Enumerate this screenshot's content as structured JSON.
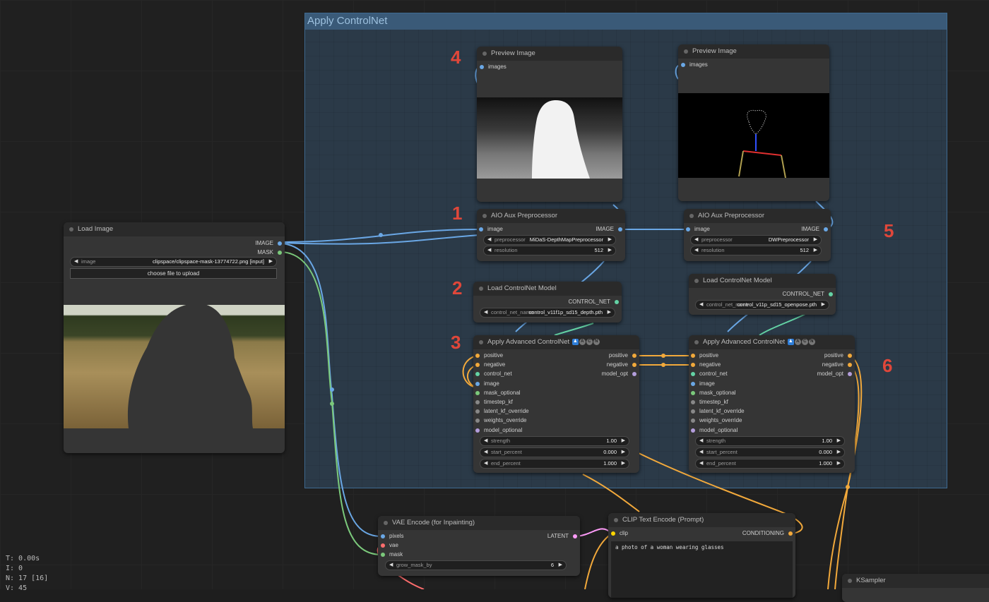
{
  "group": {
    "title": "Apply ControlNet"
  },
  "step_labels": [
    "1",
    "2",
    "3",
    "4",
    "5",
    "6"
  ],
  "stats": {
    "t": "T: 0.00s",
    "i": "I: 0",
    "n": "N: 17 [16]",
    "v": "V: 45"
  },
  "colors": {
    "image": "#6aa7e5",
    "mask": "#7bc97b",
    "conditioning": "#f2a93b",
    "control_net": "#64d3a5",
    "latent": "#ff9cf9",
    "vae": "#ff6e6e",
    "clip": "#ffd500",
    "model": "#b39ddb",
    "other": "#888888"
  },
  "load_image": {
    "title": "Load Image",
    "out_image": "IMAGE",
    "out_mask": "MASK",
    "image_label": "image",
    "image_value": "clipspace/clipspace-mask-13774722.png [input]",
    "upload_label": "choose file to upload"
  },
  "preview1": {
    "title": "Preview Image",
    "in_images": "images"
  },
  "preview2": {
    "title": "Preview Image",
    "in_images": "images"
  },
  "aio1": {
    "title": "AIO Aux Preprocessor",
    "in_image": "image",
    "out_image": "IMAGE",
    "preprocessor_label": "preprocessor",
    "preprocessor_value": "MiDaS-DepthMapPreprocessor",
    "resolution_label": "resolution",
    "resolution_value": "512"
  },
  "aio2": {
    "title": "AIO Aux Preprocessor",
    "in_image": "image",
    "out_image": "IMAGE",
    "preprocessor_label": "preprocessor",
    "preprocessor_value": "DWPreprocessor",
    "resolution_label": "resolution",
    "resolution_value": "512"
  },
  "lcm1": {
    "title": "Load ControlNet Model",
    "out": "CONTROL_NET",
    "name_label": "control_net_name",
    "name_value": "control_v11f1p_sd15_depth.pth"
  },
  "lcm2": {
    "title": "Load ControlNet Model",
    "out": "CONTROL_NET",
    "name_label": "control_net_name",
    "name_value": "control_v11p_sd15_openpose.pth"
  },
  "acn1": {
    "title": "Apply Advanced ControlNet",
    "badges": [
      "A",
      "C",
      "N"
    ],
    "inputs": [
      "positive",
      "negative",
      "control_net",
      "image",
      "mask_optional",
      "timestep_kf",
      "latent_kf_override",
      "weights_override",
      "model_optional"
    ],
    "outputs": [
      "positive",
      "negative",
      "model_opt"
    ],
    "widgets": [
      {
        "name": "strength",
        "value": "1.00"
      },
      {
        "name": "start_percent",
        "value": "0.000"
      },
      {
        "name": "end_percent",
        "value": "1.000"
      }
    ]
  },
  "acn2": {
    "title": "Apply Advanced ControlNet",
    "badges": [
      "A",
      "C",
      "N"
    ],
    "inputs": [
      "positive",
      "negative",
      "control_net",
      "image",
      "mask_optional",
      "timestep_kf",
      "latent_kf_override",
      "weights_override",
      "model_optional"
    ],
    "outputs": [
      "positive",
      "negative",
      "model_opt"
    ],
    "widgets": [
      {
        "name": "strength",
        "value": "1.00"
      },
      {
        "name": "start_percent",
        "value": "0.000"
      },
      {
        "name": "end_percent",
        "value": "1.000"
      }
    ]
  },
  "vae_encode": {
    "title": "VAE Encode (for Inpainting)",
    "in_pixels": "pixels",
    "in_vae": "vae",
    "in_mask": "mask",
    "out": "LATENT",
    "grow_label": "grow_mask_by",
    "grow_value": "6"
  },
  "clip_encode": {
    "title": "CLIP Text Encode (Prompt)",
    "in_clip": "clip",
    "out": "CONDITIONING",
    "text": "a photo of a woman wearing glasses"
  },
  "ksampler": {
    "title": "KSampler"
  }
}
